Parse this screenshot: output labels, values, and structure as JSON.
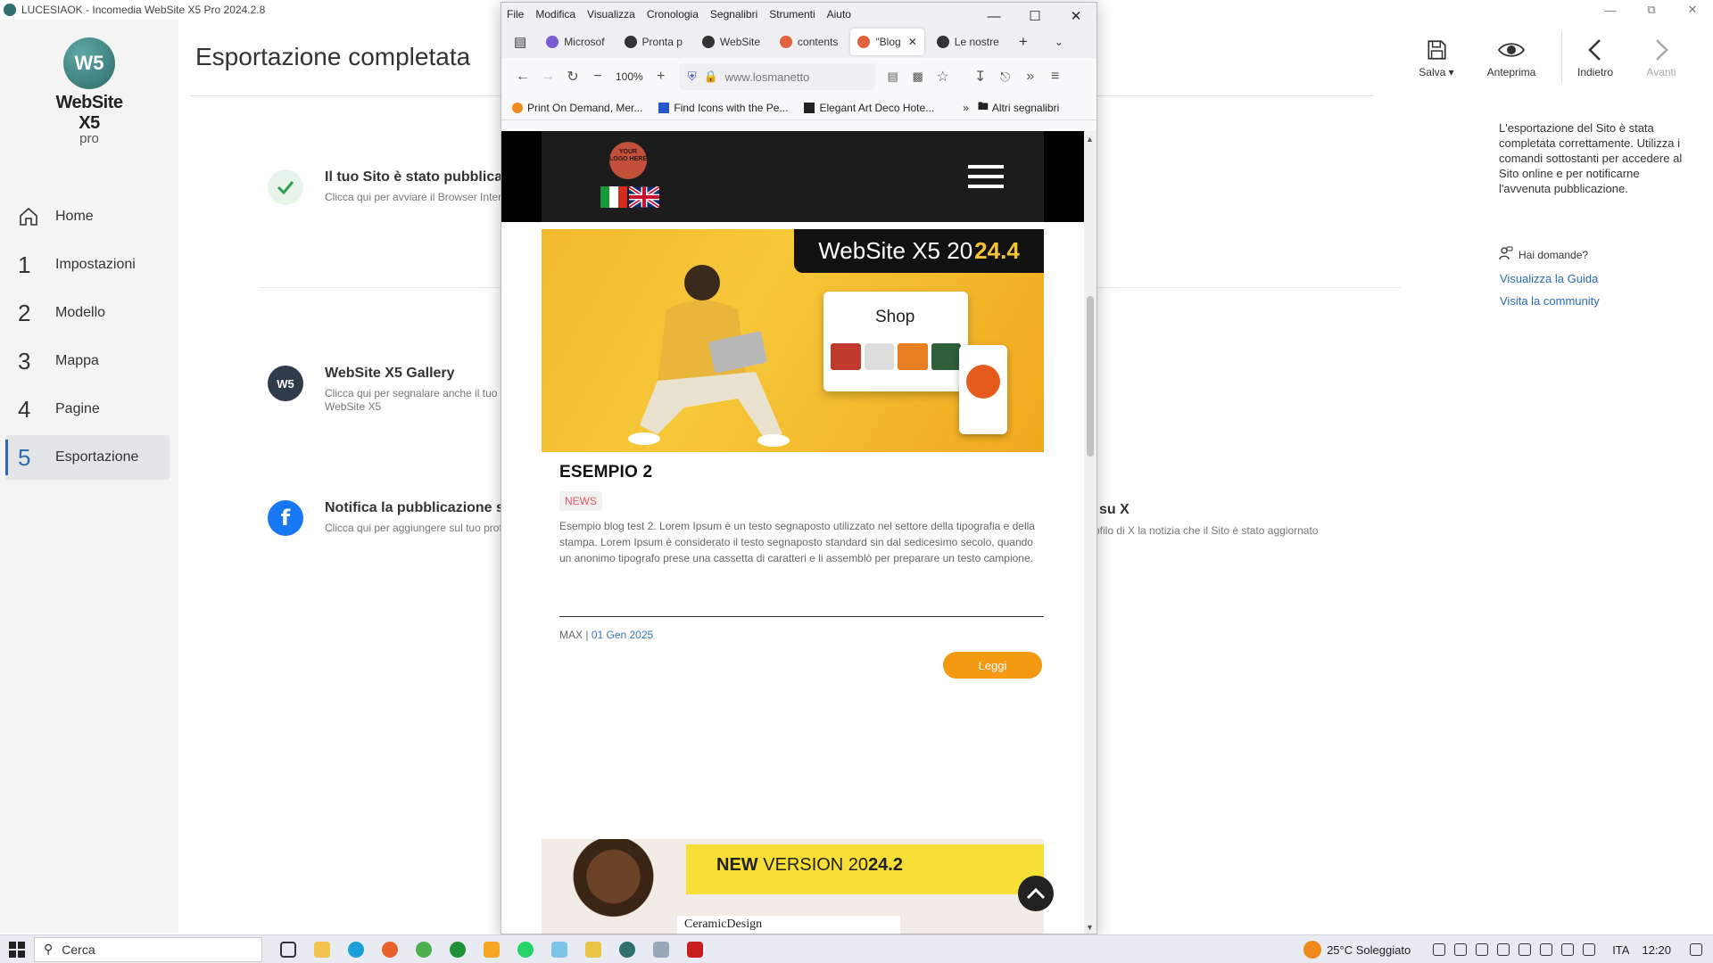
{
  "app": {
    "window_title": "LUCESIAOK - Incomedia WebSite X5 Pro 2024.2.8",
    "logo_name": "WebSite X5",
    "logo_edition": "pro",
    "logo_mark": "W5",
    "page_title": "Esportazione completata"
  },
  "nav": {
    "items": [
      {
        "num": "",
        "label": "Home"
      },
      {
        "num": "1",
        "label": "Impostazioni"
      },
      {
        "num": "2",
        "label": "Modello"
      },
      {
        "num": "3",
        "label": "Mappa"
      },
      {
        "num": "4",
        "label": "Pagine"
      },
      {
        "num": "5",
        "label": "Esportazione"
      }
    ],
    "active": "Esportazione"
  },
  "rows": {
    "published_title": "Il tuo Sito è stato pubblicat",
    "published_sub": "Clicca qui per avviare il Browser Intern",
    "gallery_title": "WebSite X5 Gallery",
    "gallery_sub1": "Clicca qui per segnalare anche il tuo S",
    "gallery_sub2": "WebSite X5",
    "gallery_icon": "W5",
    "fb_title": "Notifica la pubblicazione su",
    "fb_sub": "Clicca qui per aggiungere sul tuo prof",
    "x_title": "su X",
    "x_sub": "rofilo di X la notizia che il Sito è stato aggiornato"
  },
  "toolbar": {
    "save": "Salva",
    "preview": "Anteprima",
    "back": "Indietro",
    "forward": "Avanti"
  },
  "info": {
    "text": "L'esportazione del Sito è stata completata correttamente. Utilizza i comandi sottostanti per accedere al Sito online e per notificarne l'avvenuta pubblicazione.",
    "help_title": "Hai domande?",
    "guide_link": "Visualizza la Guida",
    "community_link": "Visita la community"
  },
  "firefox": {
    "menu": [
      "File",
      "Modifica",
      "Visualizza",
      "Cronologia",
      "Segnalibri",
      "Strumenti",
      "Aiuto"
    ],
    "tabs": [
      {
        "label": "Microsof",
        "color": "#7b5cd6"
      },
      {
        "label": "Pronta p",
        "color": "#333333"
      },
      {
        "label": "WebSite",
        "color": "#333333"
      },
      {
        "label": "contents",
        "color": "#e0623a"
      },
      {
        "label": "\"Blog",
        "color": "#e0623a"
      },
      {
        "label": "Le nostre",
        "color": "#333333"
      }
    ],
    "zoom": "100%",
    "url": "www.losmanetto",
    "bookmarks": [
      "Print On Demand, Mer...",
      "Find Icons with the Pe...",
      "Elegant Art Deco Hote..."
    ],
    "other_bookmarks": "Altri segnalibri"
  },
  "site": {
    "logo_text": "YOUR LOGO HERE",
    "hero_badge_prefix": "WebSite X5 20",
    "hero_badge_bold": "24.4",
    "hero_shop": "Shop",
    "post_title": "ESEMPIO 2",
    "post_tag": "NEWS",
    "post_excerpt": "Esempio blog test 2. Lorem Ipsum è un testo segnaposto utilizzato nel settore della tipografia e della stampa. Lorem Ipsum è considerato il testo segnaposto standard sin dal sedicesimo secolo, quando un anonimo tipografo prese una cassetta di caratteri e li assemblò per preparare un testo campione.",
    "post_author": "MAX",
    "post_date": "01 Gen 2025",
    "read_button": "Leggi",
    "banner_new": "NEW",
    "banner_version": " VERSION 20",
    "banner_version_bold": "24.2",
    "banner_brand": "CeramicDesign"
  },
  "taskbar": {
    "search": "Cerca",
    "weather": "25°C  Soleggiato",
    "lang": "ITA",
    "time": "12:20"
  }
}
